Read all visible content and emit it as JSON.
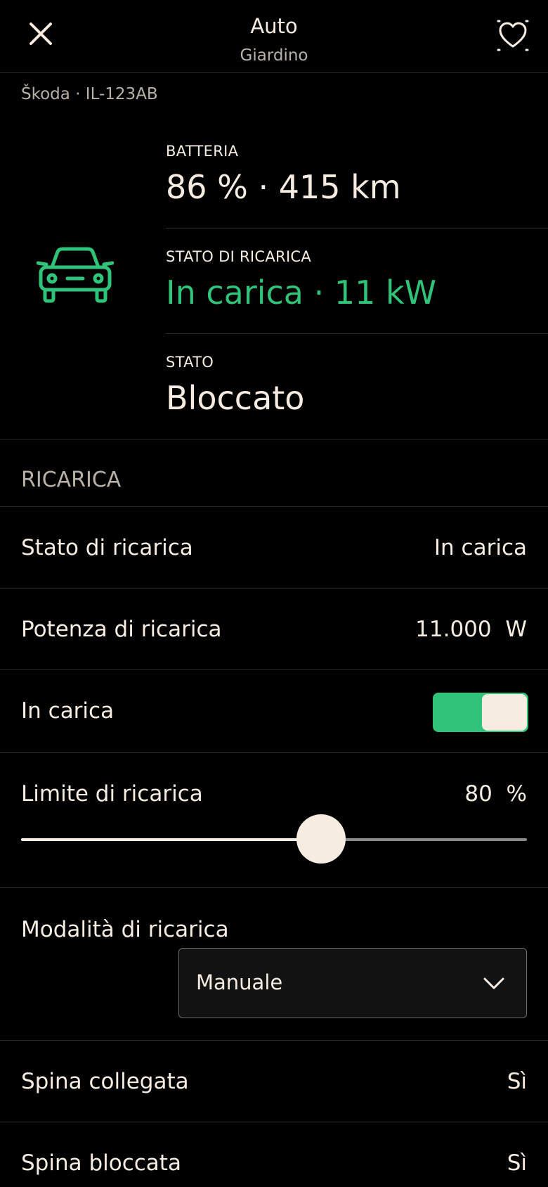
{
  "header": {
    "title": "Auto",
    "subtitle": "Giardino"
  },
  "vehicle": {
    "id_line": "Škoda · IL-123AB"
  },
  "summary": [
    {
      "label": "BATTERIA",
      "value": "86 % · 415 km"
    },
    {
      "label": "STATO DI RICARICA",
      "value": "In carica · 11 kW"
    },
    {
      "label": "STATO",
      "value": "Bloccato"
    }
  ],
  "section": {
    "title": "RICARICA"
  },
  "rows": {
    "charging_state": {
      "label": "Stato di ricarica",
      "value": "In carica"
    },
    "charging_power": {
      "label": "Potenza di ricarica",
      "value": "11.000  W"
    },
    "charging_toggle": {
      "label": "In carica",
      "on": true
    },
    "charge_limit": {
      "label": "Limite di ricarica",
      "value": "80  %",
      "percent": 80,
      "slider_fraction": 0.593
    },
    "charge_mode": {
      "label": "Modalità di ricarica",
      "selected": "Manuale"
    },
    "plug_connected": {
      "label": "Spina collegata",
      "value": "Sì"
    },
    "plug_locked": {
      "label": "Spina bloccata",
      "value": "Sì"
    }
  },
  "colors": {
    "accent": "#2fc47a",
    "text": "#f7ece1",
    "muted": "#b9b1a8",
    "background": "#000000"
  },
  "icons": {
    "close": "close-icon",
    "favorite": "heart-icon",
    "vehicle": "car-icon",
    "dropdown": "chevron-down-icon"
  }
}
